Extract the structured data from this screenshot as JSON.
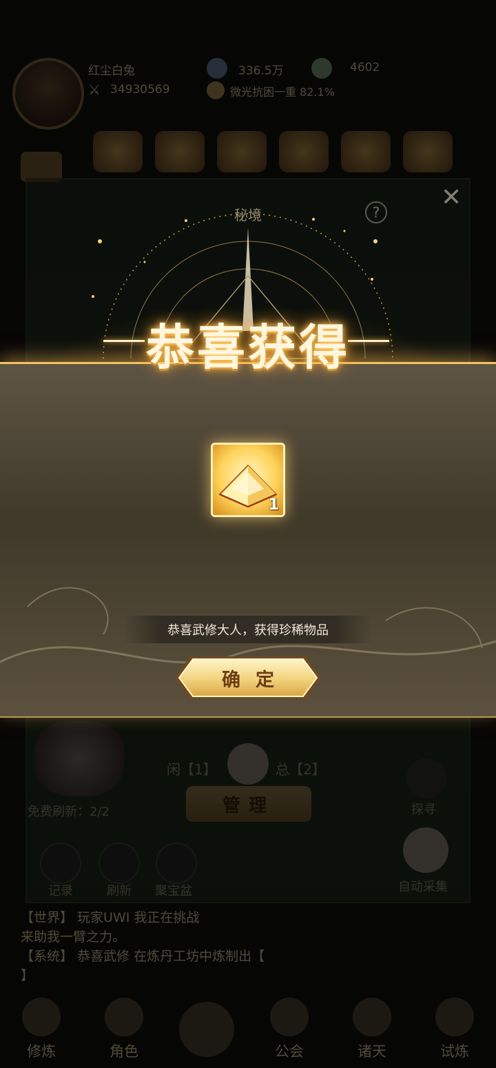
{
  "player": {
    "name": "红尘白兔",
    "power": "34930569",
    "resource1": "336.5万",
    "resource2": "4602",
    "progress": "微光抗困一重 82.1%"
  },
  "background": {
    "free_refresh": "免费刷新：2/2",
    "idle": "闲【1】",
    "total": "总【2】",
    "manage_label": "管理",
    "explore_label": "探寻",
    "buttons": [
      {
        "label": "记录",
        "icon": "record-icon"
      },
      {
        "label": "刷新",
        "icon": "refresh-icon"
      },
      {
        "label": "聚宝盆",
        "icon": "treasure-bowl-icon"
      }
    ],
    "auto_collect_label": "自动采集",
    "chat": [
      "【世界】 玩家UWI 我正在挑战",
      "来助我一臂之力。",
      "【系统】 恭喜武修 在炼丹工坊中炼制出【",
      "】"
    ],
    "nav": [
      {
        "label": "修炼"
      },
      {
        "label": "角色"
      },
      {
        "label": ""
      },
      {
        "label": "公会"
      },
      {
        "label": "诸天"
      },
      {
        "label": "试炼"
      }
    ]
  },
  "modal": {
    "panel_title": "秘境",
    "help_symbol": "?",
    "close_symbol": "✕",
    "congrats_title": "恭喜获得",
    "reward": {
      "name": "golden-pyramid-item",
      "quantity": "1"
    },
    "message": "恭喜武修大人，获得珍稀物品",
    "confirm_label": "确定"
  },
  "colors": {
    "gold": "#f4c35e",
    "band": "#4a4233",
    "confirm_text": "#6b3d12"
  }
}
